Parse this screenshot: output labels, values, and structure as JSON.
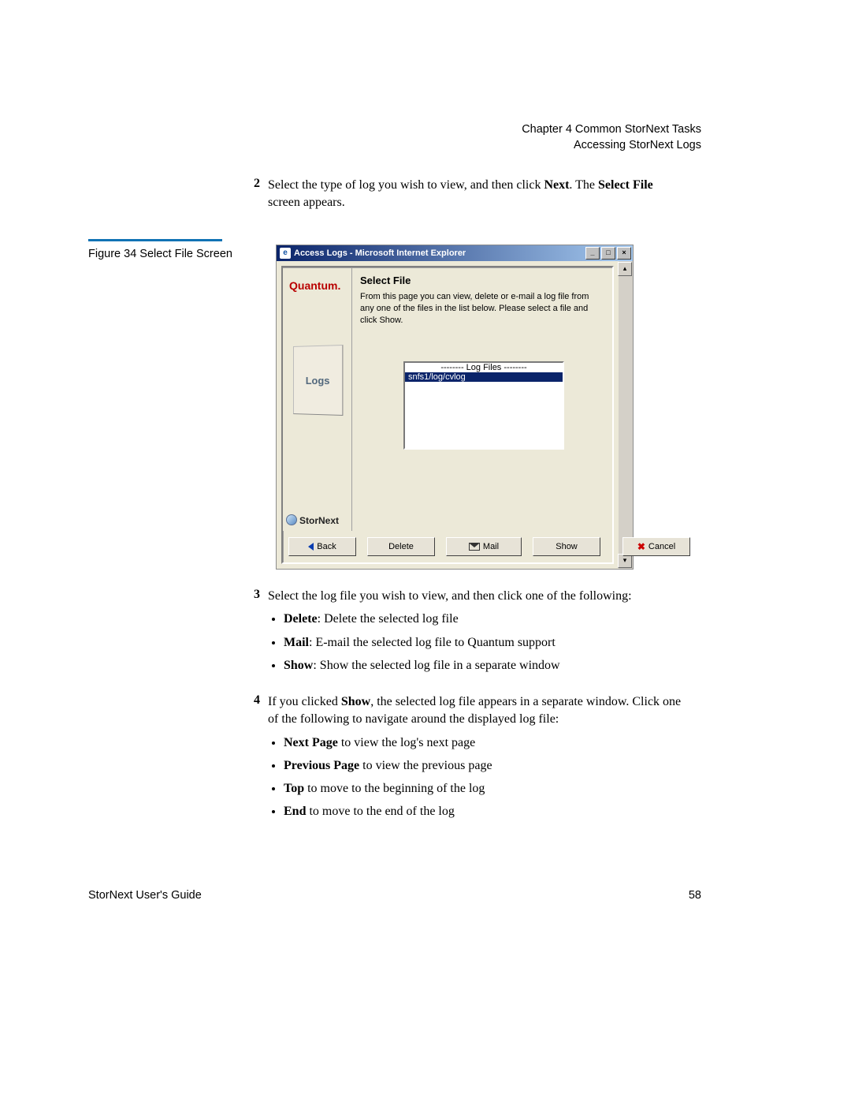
{
  "header": {
    "chapter_line": "Chapter 4  Common StorNext Tasks",
    "section_line": "Accessing StorNext Logs"
  },
  "step2": {
    "num": "2",
    "text_a": "Select the type of log you wish to view, and then click ",
    "bold_a": "Next",
    "text_b": ". The ",
    "bold_b": "Select File",
    "text_c": " screen appears."
  },
  "figure_caption": "Figure 34  Select File Screen",
  "screenshot": {
    "window_title": "Access Logs - Microsoft Internet Explorer",
    "win_min": "_",
    "win_max": "□",
    "win_close": "×",
    "brand": "Quantum.",
    "logs_label": "Logs",
    "stornext_label": "StorNext",
    "sf_title": "Select File",
    "description": "From this page you can view, delete or e-mail a log file from any one of the files in the list below. Please select a file and click Show.",
    "list_header": "-------- Log Files --------",
    "list_item": "snfs1/log/cvlog",
    "btn_back": "Back",
    "btn_delete": "Delete",
    "btn_mail": "Mail",
    "btn_show": "Show",
    "btn_cancel": "Cancel",
    "scroll_up": "▴",
    "scroll_down": "▾"
  },
  "step3": {
    "num": "3",
    "intro": "Select the log file you wish to view, and then click one of the following:",
    "bullets": [
      {
        "kw": "Delete",
        "rest": ": Delete the selected log file"
      },
      {
        "kw": "Mail",
        "rest": ": E-mail the selected log file to Quantum support"
      },
      {
        "kw": "Show",
        "rest": ": Show the selected log file in a separate window"
      }
    ]
  },
  "step4": {
    "num": "4",
    "intro_a": "If you clicked ",
    "bold": "Show",
    "intro_b": ", the selected log file appears in a separate window. Click one of the following to navigate around the displayed log file:",
    "bullets": [
      {
        "kw": "Next Page",
        "rest": " to view the log's next page"
      },
      {
        "kw": "Previous Page",
        "rest": " to view the previous page"
      },
      {
        "kw": "Top",
        "rest": " to move to the beginning of the log"
      },
      {
        "kw": "End",
        "rest": " to move to the end of the log"
      }
    ]
  },
  "footer": {
    "left": "StorNext User's Guide",
    "right": "58"
  }
}
